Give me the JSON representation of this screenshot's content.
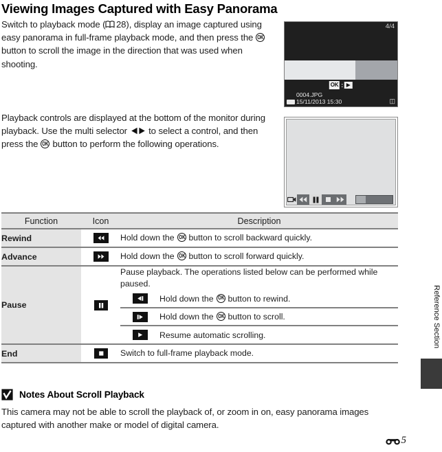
{
  "page": {
    "title": "Viewing Images Captured with Easy Panorama",
    "side_label": "Reference Section",
    "folio_number": "5",
    "folio_symbol": "reference-section-glyph"
  },
  "paragraphs": {
    "p1_part1": "Switch to playback mode (",
    "p1_page_ref": "28",
    "p1_part2": "), display an image captured using easy panorama in full-frame playback mode, and then press the ",
    "p1_part3": " button to scroll the image in the direction that was used when shooting.",
    "p2_part1": "Playback controls are displayed at the bottom of the monitor during playback. Use the multi selector ",
    "p2_part2": " to select a control, and then press the ",
    "p2_part3": " button to perform the following operations."
  },
  "monitor_top": {
    "frame_count": "4/4",
    "ok_chip_label": "OK",
    "ok_separator": ":",
    "play_icon": "play-icon",
    "file_name": "0004.JPG",
    "file_date": "15/11/2013  15:30",
    "battery_icon": "battery-icon",
    "corner_icon": "image-size-icon"
  },
  "monitor_bottom": {
    "camera_icon": "movie-camera-icon",
    "controls": [
      {
        "name": "rewind",
        "icon": "rewind-icon",
        "selected": false
      },
      {
        "name": "pause",
        "icon": "pause-icon",
        "selected": true
      },
      {
        "name": "end",
        "icon": "stop-icon",
        "selected": false
      },
      {
        "name": "advance",
        "icon": "fast-forward-icon",
        "selected": false
      }
    ],
    "progress_percent": 26
  },
  "table": {
    "headers": [
      "Function",
      "Icon",
      "Description"
    ],
    "rows": [
      {
        "function": "Rewind",
        "icon": "rewind-icon",
        "description_part1": "Hold down the ",
        "description_part2": " button to scroll backward quickly."
      },
      {
        "function": "Advance",
        "icon": "fast-forward-icon",
        "description_part1": "Hold down the ",
        "description_part2": " button to scroll forward quickly."
      },
      {
        "function": "Pause",
        "icon": "pause-icon",
        "description_intro": "Pause playback. The operations listed below can be performed while paused.",
        "sub_rows": [
          {
            "icon": "step-back-icon",
            "description_part1": "Hold down the ",
            "description_part2": " button to rewind."
          },
          {
            "icon": "step-forward-icon",
            "description_part1": "Hold down the ",
            "description_part2": " button to scroll."
          },
          {
            "icon": "play-icon",
            "description_full": "Resume automatic scrolling."
          }
        ]
      },
      {
        "function": "End",
        "icon": "stop-icon",
        "description_full": "Switch to full-frame playback mode."
      }
    ]
  },
  "notes": {
    "icon": "checkmark-caution-icon",
    "title": "Notes About Scroll Playback",
    "body": "This camera may not be able to scroll the playback of, or zoom in on, easy panorama images captured with another make or model of digital camera."
  },
  "colors": {
    "header_row_bg": "#e4e4e4",
    "rule": "#808080",
    "monitor_dark": "#1f1f1f",
    "monitor_light": "#dfe0e1",
    "side_tab": "#3a3a3a"
  }
}
